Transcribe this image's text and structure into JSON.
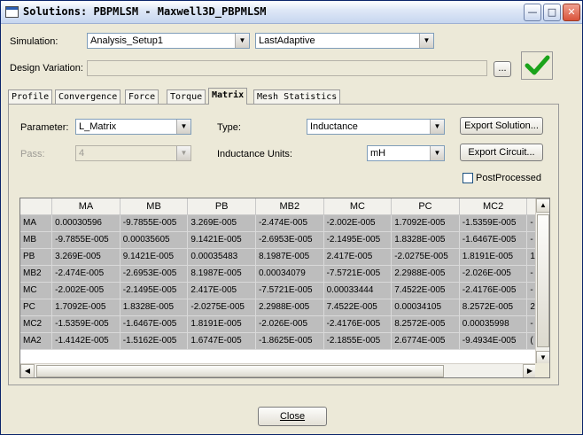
{
  "window": {
    "title": "Solutions: PBPMLSM - Maxwell3D_PBPMLSM",
    "minimize_glyph": "—",
    "maximize_glyph": "□",
    "close_glyph": "✕"
  },
  "simulation": {
    "label": "Simulation:",
    "setup_value": "Analysis_Setup1",
    "pass_value": "LastAdaptive"
  },
  "design_variation": {
    "label": "Design Variation:",
    "value": "",
    "browse_label": "..."
  },
  "tabs": [
    "Profile",
    "Convergence",
    "Force",
    "Torque",
    "Matrix",
    "Mesh Statistics"
  ],
  "active_tab": "Matrix",
  "matrix_panel": {
    "parameter_label": "Parameter:",
    "parameter_value": "L_Matrix",
    "type_label": "Type:",
    "type_value": "Inductance",
    "pass_label": "Pass:",
    "pass_value": "4",
    "units_label": "Inductance Units:",
    "units_value": "mH",
    "export_solution_label": "Export Solution...",
    "export_circuit_label": "Export Circuit...",
    "postprocessed_label": "PostProcessed",
    "postprocessed_checked": false
  },
  "matrix": {
    "columns": [
      "MA",
      "MB",
      "PB",
      "MB2",
      "MC",
      "PC",
      "MC2"
    ],
    "rows": [
      {
        "name": "MA",
        "values": [
          "0.00030596",
          "-9.7855E-005",
          "3.269E-005",
          "-2.474E-005",
          "-2.002E-005",
          "1.7092E-005",
          "-1.5359E-005"
        ],
        "overflow": "-"
      },
      {
        "name": "MB",
        "values": [
          "-9.7855E-005",
          "0.00035605",
          "9.1421E-005",
          "-2.6953E-005",
          "-2.1495E-005",
          "1.8328E-005",
          "-1.6467E-005"
        ],
        "overflow": "-"
      },
      {
        "name": "PB",
        "values": [
          "3.269E-005",
          "9.1421E-005",
          "0.00035483",
          "8.1987E-005",
          "2.417E-005",
          "-2.0275E-005",
          "1.8191E-005"
        ],
        "overflow": "1"
      },
      {
        "name": "MB2",
        "values": [
          "-2.474E-005",
          "-2.6953E-005",
          "8.1987E-005",
          "0.00034079",
          "-7.5721E-005",
          "2.2988E-005",
          "-2.026E-005"
        ],
        "overflow": "-"
      },
      {
        "name": "MC",
        "values": [
          "-2.002E-005",
          "-2.1495E-005",
          "2.417E-005",
          "-7.5721E-005",
          "0.00033444",
          "7.4522E-005",
          "-2.4176E-005"
        ],
        "overflow": "-"
      },
      {
        "name": "PC",
        "values": [
          "1.7092E-005",
          "1.8328E-005",
          "-2.0275E-005",
          "2.2988E-005",
          "7.4522E-005",
          "0.00034105",
          "8.2572E-005"
        ],
        "overflow": "2"
      },
      {
        "name": "MC2",
        "values": [
          "-1.5359E-005",
          "-1.6467E-005",
          "1.8191E-005",
          "-2.026E-005",
          "-2.4176E-005",
          "8.2572E-005",
          "0.00035998"
        ],
        "overflow": "-"
      },
      {
        "name": "MA2",
        "values": [
          "-1.4142E-005",
          "-1.5162E-005",
          "1.6747E-005",
          "-1.8625E-005",
          "-2.1855E-005",
          "2.6774E-005",
          "-9.4934E-005"
        ],
        "overflow": "("
      }
    ]
  },
  "close_button_label": "Close",
  "colors": {
    "accept_check": "#1aa31a",
    "cell_background": "#bdbdbd"
  },
  "icons": {
    "accept": "check-icon",
    "dropdown": "chevron-down-icon"
  }
}
